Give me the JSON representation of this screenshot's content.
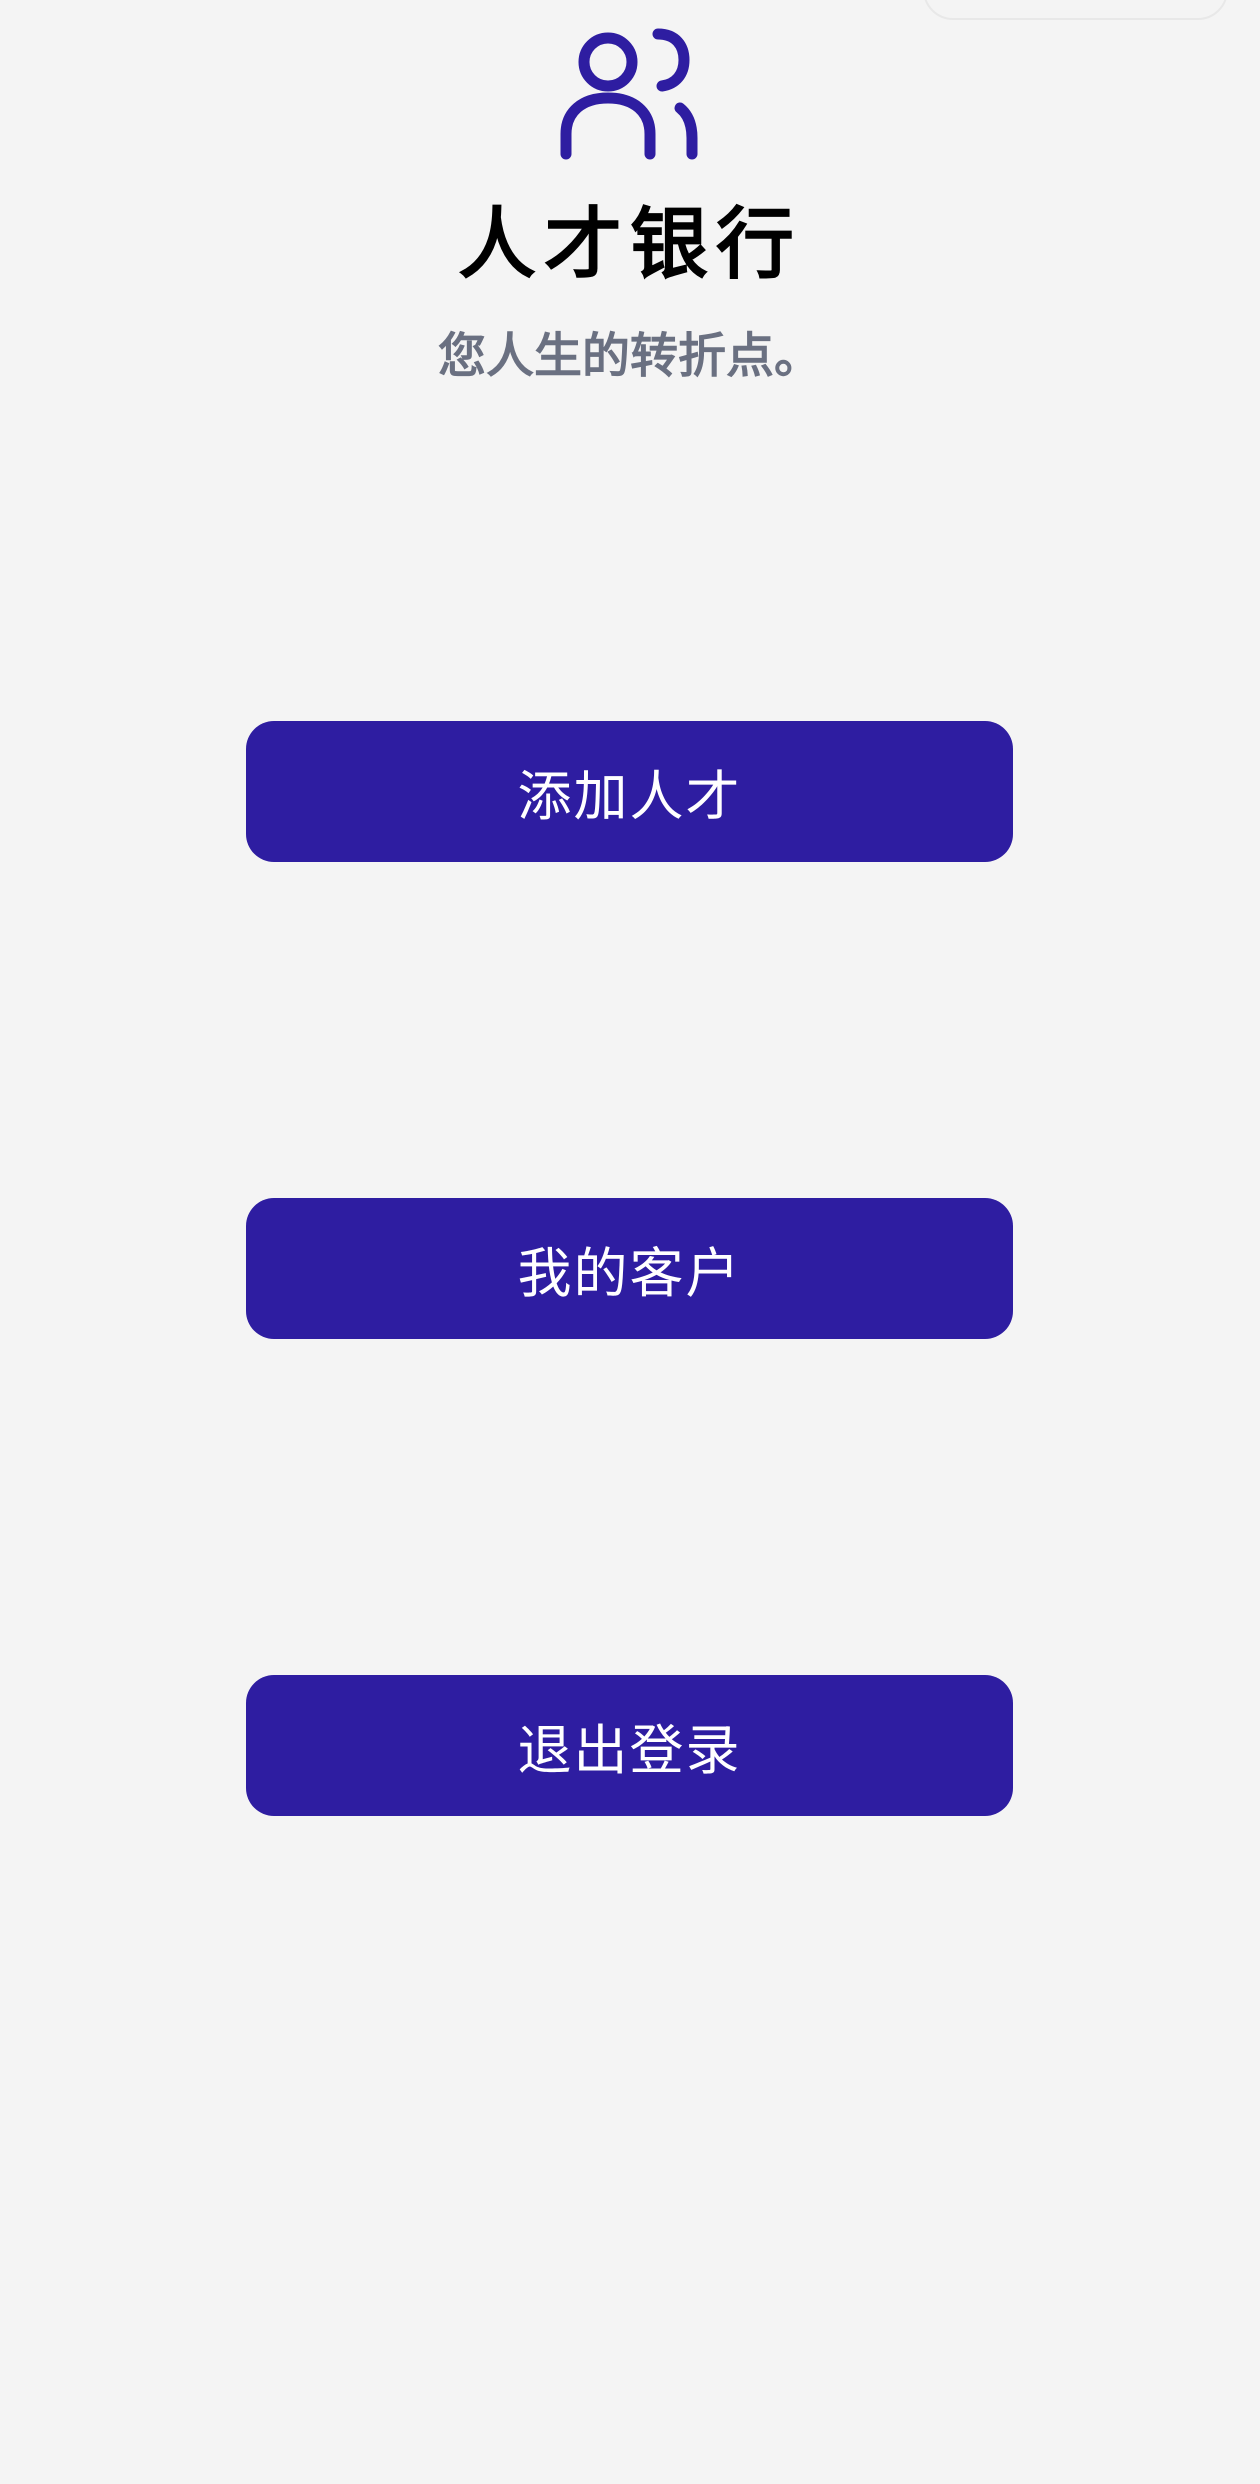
{
  "app": {
    "title": "人才银行",
    "subtitle": "您人生的转折点。",
    "logo_icon": "users-icon",
    "accent_color": "#2e1da1"
  },
  "actions": [
    {
      "label": "添加人才"
    },
    {
      "label": "我的客户"
    },
    {
      "label": "退出登录"
    }
  ]
}
